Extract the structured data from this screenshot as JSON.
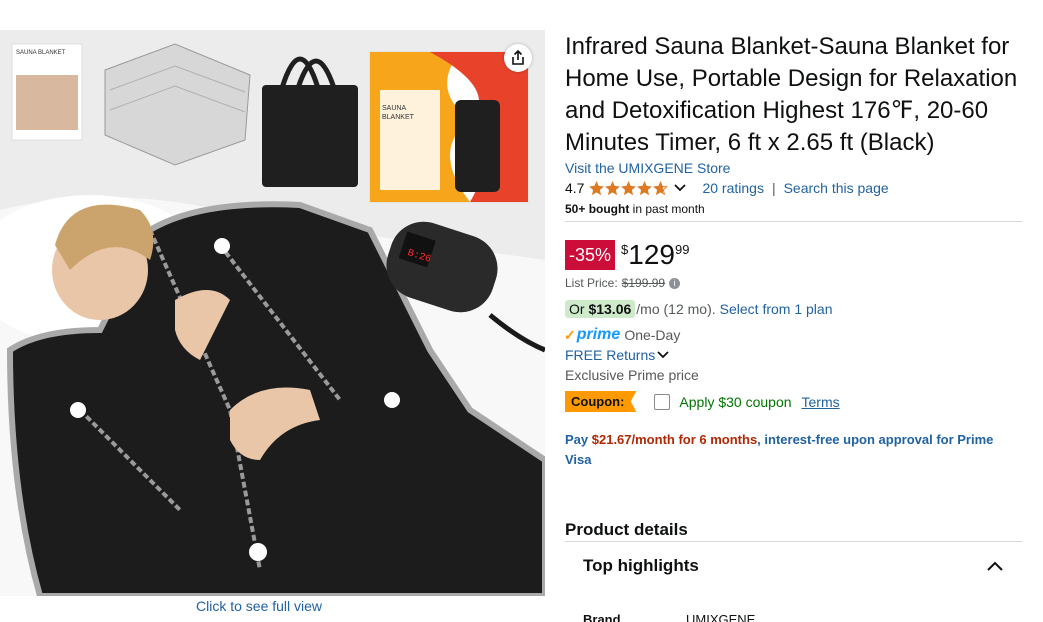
{
  "product": {
    "title": "Infrared Sauna Blanket-Sauna Blanket for Home Use, Portable Design for Relaxation and Detoxification Highest 176℉, 20-60 Minutes Timer, 6 ft x 2.65 ft  (Black)",
    "store_link": "Visit the UMIXGENE Store",
    "rating_value": "4.7",
    "rating_stars": 4.7,
    "ratings_count": "20 ratings",
    "search_page": "Search this page",
    "bought_bold": "50+ bought",
    "bought_rest": " in past month"
  },
  "image": {
    "full_view": "Click to see full view",
    "box_label_line1": "SAUNA",
    "box_label_line2": "BLANKET",
    "manual_title": "SAUNA BLANKET",
    "remote_display": "B:26"
  },
  "price": {
    "discount": "-35%",
    "currency": "$",
    "whole": "129",
    "fraction": "99",
    "list_label": "List Price:",
    "list_value": "$199.99"
  },
  "plan": {
    "or": "Or ",
    "amount": "$13.06",
    "per": "/mo (12 mo).",
    "select": "Select from 1 plan"
  },
  "shipping": {
    "prime": "prime",
    "one_day": "One-Day",
    "returns": "FREE Returns",
    "exclusive": "Exclusive Prime price"
  },
  "coupon": {
    "badge": "Coupon:",
    "apply": "Apply $30 coupon",
    "terms": "Terms"
  },
  "financing": {
    "pay_prefix": "Pay ",
    "pay_amount": "$21.67/month for 6 months",
    "pay_rest": ", interest-free upon approval for Prime Visa"
  },
  "details": {
    "heading": "Product details",
    "top_highlights": "Top highlights",
    "brand_label": "Brand",
    "brand_value": "UMIXGENE"
  },
  "colors": {
    "link": "#2162a1",
    "discount": "#cc0c39",
    "coupon": "#ff9900",
    "star": "#de7921"
  }
}
